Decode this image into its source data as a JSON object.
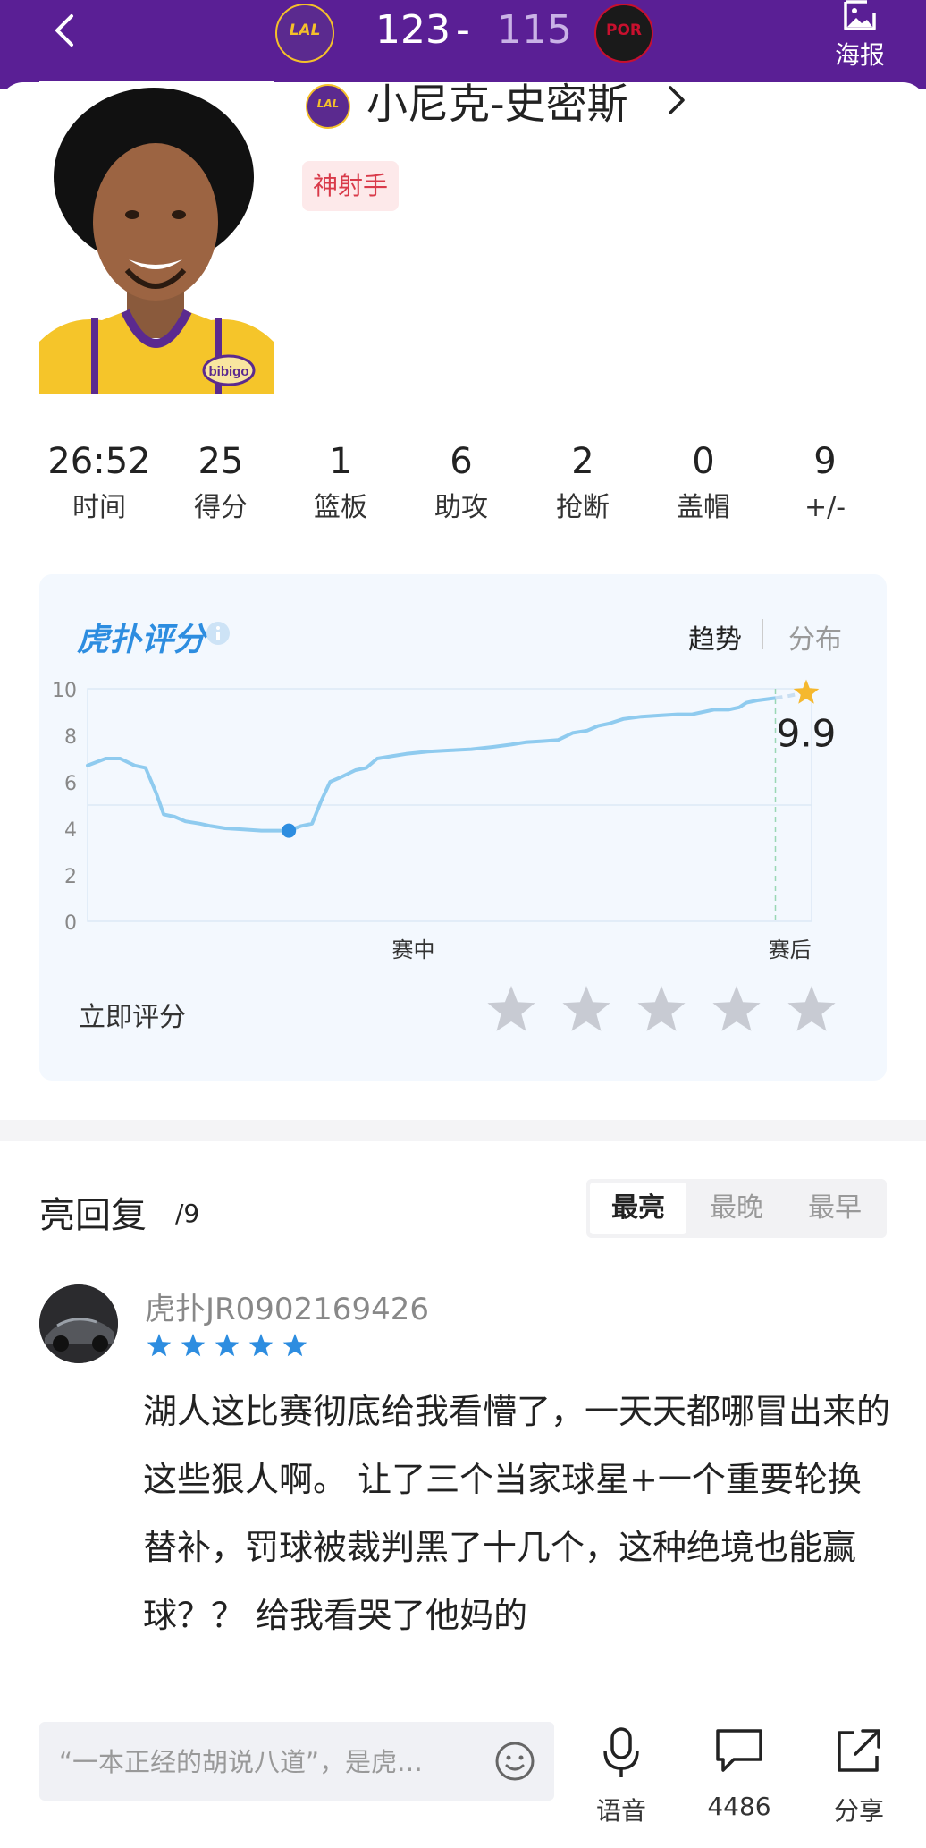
{
  "header": {
    "home_abbr": "LAL",
    "away_abbr": "POR",
    "home_score": "123",
    "separator": "-",
    "away_score": "115",
    "poster_label": "海报",
    "colors": {
      "background": "#5a1f95",
      "away_score": "#c9b2e6"
    }
  },
  "player": {
    "team_abbr": "LAL",
    "name": "小尼克-史密斯",
    "badge": "神射手",
    "jersey_text": "bibigo"
  },
  "stats": [
    {
      "value": "26:52",
      "label": "时间"
    },
    {
      "value": "25",
      "label": "得分"
    },
    {
      "value": "1",
      "label": "篮板"
    },
    {
      "value": "6",
      "label": "助攻"
    },
    {
      "value": "2",
      "label": "抢断"
    },
    {
      "value": "0",
      "label": "盖帽"
    },
    {
      "value": "9",
      "label": "+/-"
    }
  ],
  "rating": {
    "brand": "虎扑评分",
    "brand_mark": "®",
    "tabs": [
      "趋势",
      "分布"
    ],
    "active_tab": "趋势",
    "rate_now_label": "立即评分",
    "star_count": 5,
    "colors": {
      "line": "#8fcbef",
      "marker": "#2d8de0",
      "star_empty": "#c8cbd3",
      "star_gold": "#f5b82e"
    }
  },
  "chart_data": {
    "type": "line",
    "yticks": [
      "10",
      "8",
      "6",
      "4",
      "2",
      "0"
    ],
    "ylim": [
      0,
      10
    ],
    "xlim": [
      0,
      100
    ],
    "xtick_labels": [
      {
        "x": 45,
        "label": "赛中"
      },
      {
        "x": 97,
        "label": "赛后"
      }
    ],
    "final_value_label": "9.9",
    "lowest_point_index": 15,
    "series": [
      {
        "values": [
          {
            "x": 0,
            "y": 6.7
          },
          {
            "x": 2.5,
            "y": 7.0
          },
          {
            "x": 4.5,
            "y": 7.0
          },
          {
            "x": 6.5,
            "y": 6.7
          },
          {
            "x": 8,
            "y": 6.6
          },
          {
            "x": 9.5,
            "y": 5.5
          },
          {
            "x": 10.5,
            "y": 4.6
          },
          {
            "x": 12,
            "y": 4.5
          },
          {
            "x": 13.5,
            "y": 4.3
          },
          {
            "x": 15.5,
            "y": 4.2
          },
          {
            "x": 17,
            "y": 4.1
          },
          {
            "x": 19,
            "y": 4.0
          },
          {
            "x": 21.5,
            "y": 3.95
          },
          {
            "x": 24,
            "y": 3.9
          },
          {
            "x": 26,
            "y": 3.9
          },
          {
            "x": 27.8,
            "y": 3.9
          },
          {
            "x": 29.5,
            "y": 4.1
          },
          {
            "x": 31,
            "y": 4.2
          },
          {
            "x": 32.3,
            "y": 5.2
          },
          {
            "x": 33.5,
            "y": 6.0
          },
          {
            "x": 35,
            "y": 6.2
          },
          {
            "x": 37,
            "y": 6.5
          },
          {
            "x": 38.5,
            "y": 6.6
          },
          {
            "x": 40,
            "y": 7.0
          },
          {
            "x": 42,
            "y": 7.1
          },
          {
            "x": 44,
            "y": 7.2
          },
          {
            "x": 47,
            "y": 7.3
          },
          {
            "x": 50,
            "y": 7.35
          },
          {
            "x": 53,
            "y": 7.4
          },
          {
            "x": 56,
            "y": 7.5
          },
          {
            "x": 58.5,
            "y": 7.6
          },
          {
            "x": 60.5,
            "y": 7.7
          },
          {
            "x": 63,
            "y": 7.75
          },
          {
            "x": 65,
            "y": 7.8
          },
          {
            "x": 67,
            "y": 8.1
          },
          {
            "x": 69,
            "y": 8.2
          },
          {
            "x": 70.5,
            "y": 8.4
          },
          {
            "x": 72,
            "y": 8.5
          },
          {
            "x": 74,
            "y": 8.7
          },
          {
            "x": 76.5,
            "y": 8.8
          },
          {
            "x": 79,
            "y": 8.85
          },
          {
            "x": 81.5,
            "y": 8.9
          },
          {
            "x": 83.5,
            "y": 8.9
          },
          {
            "x": 85,
            "y": 9.0
          },
          {
            "x": 86.5,
            "y": 9.1
          },
          {
            "x": 88.5,
            "y": 9.1
          },
          {
            "x": 90,
            "y": 9.2
          },
          {
            "x": 91,
            "y": 9.4
          },
          {
            "x": 92.5,
            "y": 9.5
          },
          {
            "x": 95,
            "y": 9.6
          }
        ]
      }
    ],
    "projection": [
      {
        "x": 95,
        "y": 9.6
      },
      {
        "x": 97,
        "y": 9.7
      },
      {
        "x": 100,
        "y": 9.9
      }
    ]
  },
  "replies": {
    "title": "亮回复",
    "count": "/9",
    "sort_tabs": [
      "最亮",
      "最晚",
      "最早"
    ],
    "active_sort": "最亮",
    "items": [
      {
        "username": "虎扑JR0902169426",
        "star_count": 5,
        "text": "湖人这比赛彻底给我看懵了，一天天都哪冒出来的这些狠人啊。 让了三个当家球星+一个重要轮换替补，罚球被裁判黑了十几个，这种绝境也能赢球？？    给我看哭了他妈的"
      }
    ]
  },
  "bottom_bar": {
    "input_placeholder": "“一本正经的胡说八道”，是虎…",
    "voice_label": "语音",
    "comment_count": "4486",
    "share_label": "分享"
  }
}
